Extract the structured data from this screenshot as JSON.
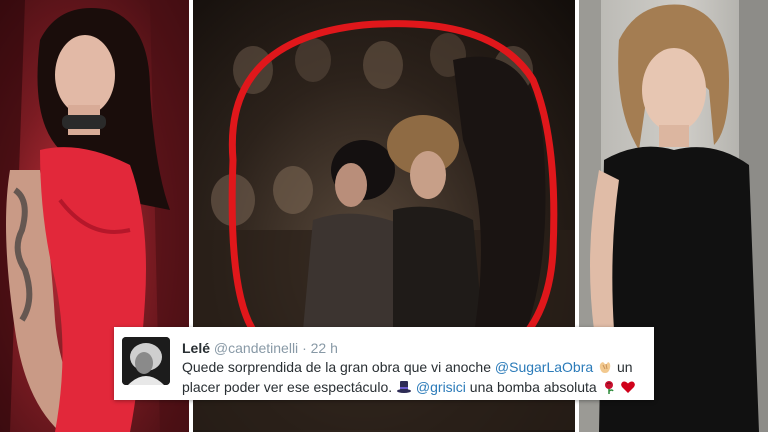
{
  "tweet": {
    "display_name": "Lelé",
    "handle": "@candetinelli",
    "separator": "·",
    "time": "22 h",
    "text_part1": "Quede sorprendida de la gran obra que vi anoche ",
    "mention1": "@SugarLaObra",
    "text_part2": " un placer poder ver ese espectáculo. ",
    "mention2": "@grisici",
    "text_part3": " una bomba absoluta ",
    "emoji_icons": [
      "clapping-hands-icon",
      "top-hat-icon",
      "rose-icon",
      "heart-icon"
    ]
  },
  "colors": {
    "circle_annotation": "#e0171b",
    "mention": "#2b7bb9",
    "name": "#292f33",
    "meta": "#8899a6",
    "left_dress": "#e2283a",
    "right_shirt": "#111111"
  }
}
